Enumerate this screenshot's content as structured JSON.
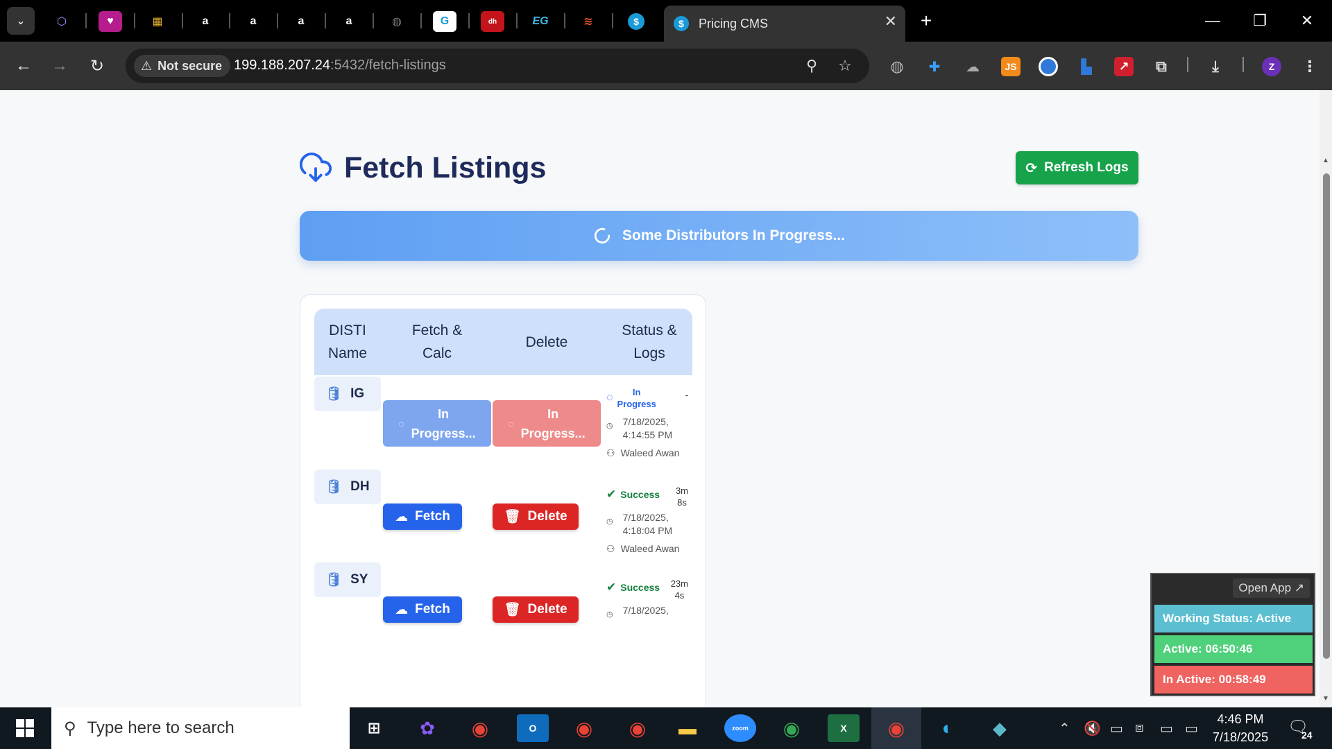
{
  "browser": {
    "active_tab_title": "Pricing CMS",
    "active_tab_favicon": "$",
    "not_secure_label": "Not secure",
    "url_host": "199.188.207.24",
    "url_rest": ":5432/fetch-listings",
    "pinned_tabs": [
      "cube-icon",
      "app-icon",
      "box-icon",
      "a",
      "a",
      "a",
      "a",
      "globe-icon",
      "g-icon",
      "dh",
      "EG",
      "layers-icon",
      "$"
    ]
  },
  "page": {
    "title": "Fetch Listings",
    "refresh_label": "Refresh Logs",
    "banner_text": "Some Distributors In Progress...",
    "table": {
      "headers": [
        "DISTI Name",
        "Fetch & Calc",
        "Delete",
        "Status & Logs"
      ],
      "header_lines": [
        [
          "DISTI",
          "Name"
        ],
        [
          "Fetch &",
          "Calc"
        ],
        [
          "Delete"
        ],
        [
          "Status &",
          "Logs"
        ]
      ],
      "rows": [
        {
          "name": "IG",
          "fetch_label": [
            "In",
            "Progress..."
          ],
          "delete_label": [
            "In",
            "Progress..."
          ],
          "status": [
            "In",
            "Progress"
          ],
          "duration": "-",
          "date": "7/18/2025,",
          "time": "4:14:55 PM",
          "user": "Waleed Awan"
        },
        {
          "name": "DH",
          "fetch_label": "Fetch",
          "delete_label": "Delete",
          "status": "Success",
          "duration": [
            "3m",
            "8s"
          ],
          "date": "7/18/2025,",
          "time": "4:18:04 PM",
          "user": "Waleed Awan"
        },
        {
          "name": "SY",
          "fetch_label": "Fetch",
          "delete_label": "Delete",
          "status": "Success",
          "duration": [
            "23m",
            "4s"
          ],
          "date": "7/18/2025,",
          "time": "",
          "user": ""
        }
      ]
    }
  },
  "widget": {
    "open_app_label": "Open App ↗",
    "working_status": "Working Status: Active",
    "active": "Active: 06:50:46",
    "inactive": "In Active: 00:58:49"
  },
  "taskbar": {
    "search_placeholder": "Type here to search",
    "time": "4:46 PM",
    "date": "7/18/2025",
    "notification_count": "24"
  },
  "colors": {
    "accent_blue": "#2563eb",
    "success_green": "#17a34a",
    "danger_red": "#dc2626",
    "banner_start": "#5e9ff3",
    "banner_end": "#8ebff9"
  }
}
